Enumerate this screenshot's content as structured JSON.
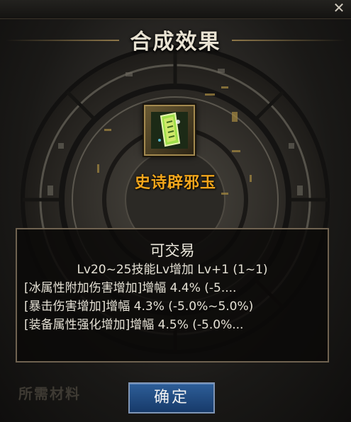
{
  "window": {
    "close_icon": "close-icon",
    "title": "合成效果"
  },
  "item": {
    "icon": "jade-charm-icon",
    "name": "史诗辟邪玉",
    "name_color": "#f2a61c"
  },
  "stats": {
    "tradeable": "可交易",
    "lines": [
      "Lv20~25技能Lv增加 Lv+1 (1~1)",
      "[冰属性附加伤害增加]增幅 4.4% (-5....",
      "[暴击伤害增加]增幅 4.3% (-5.0%~5.0%)",
      "[装备属性强化增加]增幅 4.5% (-5.0%..."
    ]
  },
  "footer": {
    "materials_label": "所需材料",
    "confirm_label": "确定",
    "confirm_color": "#2d5e98"
  }
}
